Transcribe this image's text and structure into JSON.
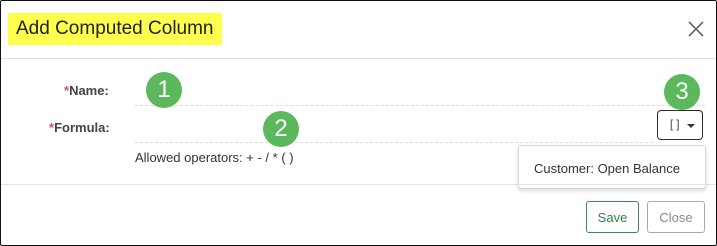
{
  "dialog": {
    "title": "Add Computed Column",
    "close_icon": "close-icon"
  },
  "form": {
    "name": {
      "required_mark": "*",
      "label": "Name:",
      "value": ""
    },
    "formula": {
      "required_mark": "*",
      "label": "Formula:",
      "value": "",
      "hint": "Allowed operators: + - / * ( )"
    },
    "insert_field_button": {
      "icon": "brackets-icon",
      "glyph": "[]",
      "caret_icon": "caret-down-icon"
    },
    "dropdown": {
      "items": [
        "Customer: Open Balance"
      ]
    }
  },
  "callouts": [
    "1",
    "2",
    "3"
  ],
  "footer": {
    "save_label": "Save",
    "close_label": "Close"
  },
  "colors": {
    "title_highlight": "#ffff4d",
    "required": "#d9534f",
    "callout": "#5cb85c",
    "save": "#2e7d4f"
  }
}
